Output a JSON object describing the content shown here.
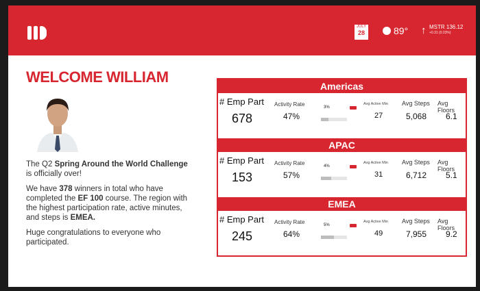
{
  "header": {
    "calendar": {
      "month": "JULY",
      "day": "28"
    },
    "weather": {
      "temp": "89°"
    },
    "stock": {
      "ticker": "MSTR 136.12",
      "change": "+0.31 (0.23%)",
      "direction_icon": "arrow-up-icon"
    }
  },
  "welcome": {
    "title": "WELCOME WILLIAM"
  },
  "message": {
    "p1_pre": "The Q2 ",
    "p1_bold": "Spring Around the World Challenge",
    "p1_post": " is officially over!",
    "p2_pre": "We have ",
    "p2_bold1": "378",
    "p2_mid1": " winners in total who have completed the ",
    "p2_bold2": "EF 100",
    "p2_mid2": " course. The region with the highest participation rate, active minutes, and steps is ",
    "p2_bold3": "EMEA.",
    "p3": "Huge congratulations to everyone who participated."
  },
  "labels": {
    "emp": "# Emp Part",
    "activity": "Activity Rate",
    "active_min": "Avg Active Min",
    "steps": "Avg Steps",
    "floors": "Avg Floors"
  },
  "regions": [
    {
      "name": "Americas",
      "emp": "678",
      "activity": "47%",
      "mini_pct": "3%",
      "mini_fill": 0.3,
      "active_min": "27",
      "steps": "5,068",
      "floors": "6.1"
    },
    {
      "name": "APAC",
      "emp": "153",
      "activity": "57%",
      "mini_pct": "4%",
      "mini_fill": 0.4,
      "active_min": "31",
      "steps": "6,712",
      "floors": "5.1"
    },
    {
      "name": "EMEA",
      "emp": "245",
      "activity": "64%",
      "mini_pct": "5%",
      "mini_fill": 0.5,
      "active_min": "49",
      "steps": "7,955",
      "floors": "9.2"
    }
  ],
  "colors": {
    "accent": "#d7262f"
  }
}
